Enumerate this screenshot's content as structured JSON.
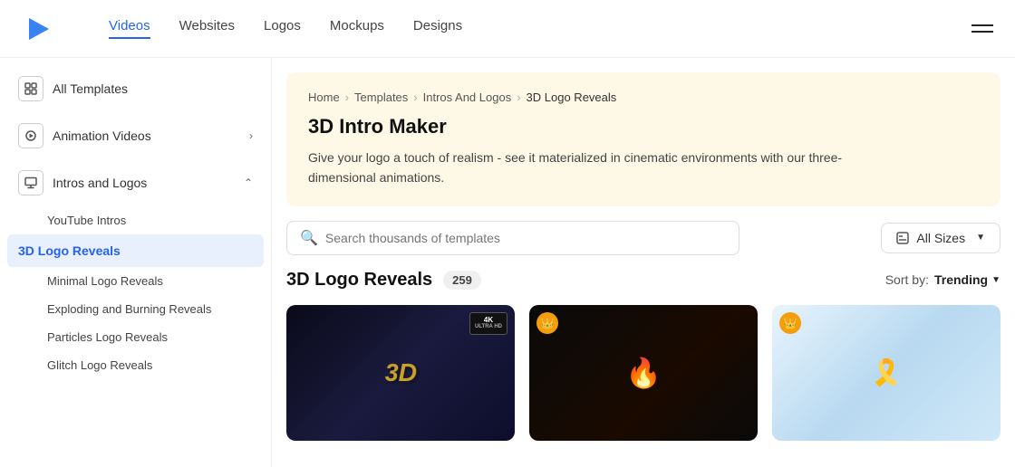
{
  "header": {
    "nav": [
      {
        "label": "Videos",
        "active": true
      },
      {
        "label": "Websites",
        "active": false
      },
      {
        "label": "Logos",
        "active": false
      },
      {
        "label": "Mockups",
        "active": false
      },
      {
        "label": "Designs",
        "active": false
      }
    ]
  },
  "sidebar": {
    "items": [
      {
        "id": "all-templates",
        "label": "All Templates",
        "icon": "grid"
      },
      {
        "id": "animation-videos",
        "label": "Animation Videos",
        "icon": "play",
        "hasChildren": true,
        "expanded": false
      },
      {
        "id": "intros-logos",
        "label": "Intros and Logos",
        "icon": "monitor",
        "hasChildren": true,
        "expanded": true
      },
      {
        "id": "youtube-intros",
        "label": "YouTube Intros",
        "sub": true
      },
      {
        "id": "3d-logo-reveals",
        "label": "3D Logo Reveals",
        "sub": true,
        "active": true
      },
      {
        "id": "minimal-logo",
        "label": "Minimal Logo Reveals",
        "sub": true
      },
      {
        "id": "exploding-burning",
        "label": "Exploding and Burning Reveals",
        "sub": true
      },
      {
        "id": "particles-logo",
        "label": "Particles Logo Reveals",
        "sub": true
      },
      {
        "id": "glitch-logo",
        "label": "Glitch Logo Reveals",
        "sub": true
      }
    ]
  },
  "banner": {
    "breadcrumb": {
      "home": "Home",
      "templates": "Templates",
      "intros_and_logos": "Intros And Logos",
      "current": "3D Logo Reveals"
    },
    "title": "3D Intro Maker",
    "description": "Give your logo a touch of realism - see it materialized in cinematic environments with our three-dimensional animations."
  },
  "search": {
    "placeholder": "Search thousands of templates",
    "filter_label": "All Sizes"
  },
  "results": {
    "title": "3D Logo Reveals",
    "count": "259",
    "sort_label": "Sort by:",
    "sort_value": "Trending"
  },
  "cards": [
    {
      "id": "card-1",
      "has_4k": true,
      "has_crown": false
    },
    {
      "id": "card-2",
      "has_4k": false,
      "has_crown": true
    },
    {
      "id": "card-3",
      "has_4k": false,
      "has_crown": true
    }
  ]
}
